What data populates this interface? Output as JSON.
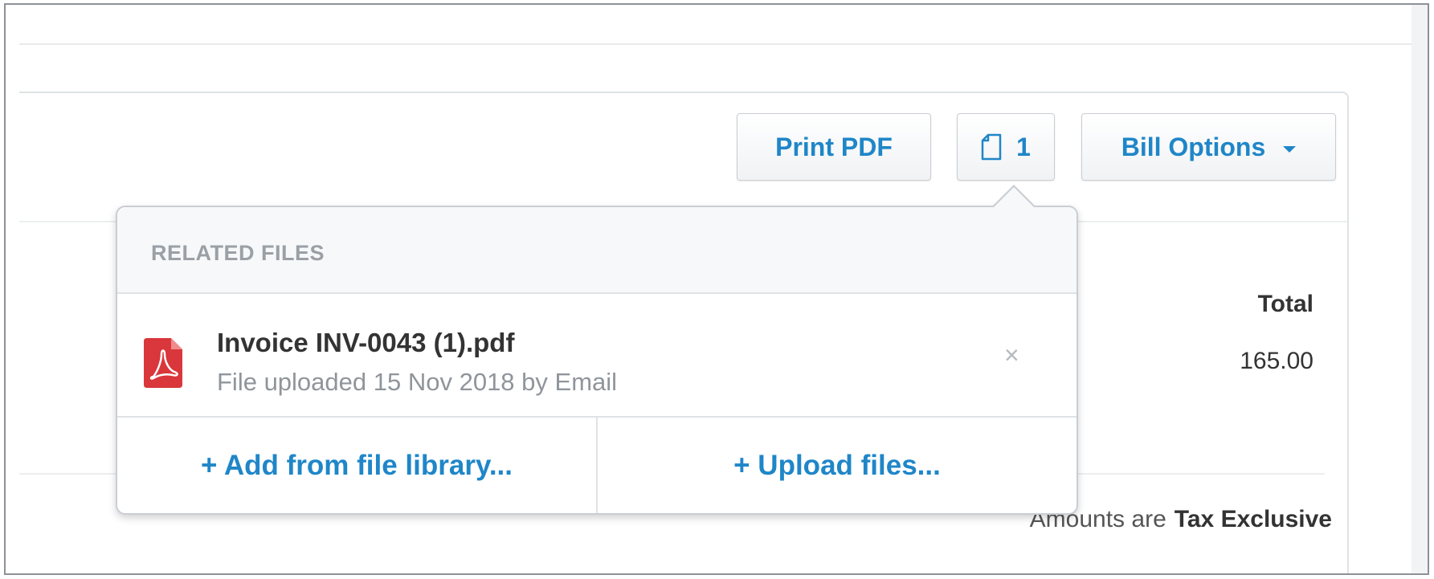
{
  "toolbar": {
    "print_pdf_label": "Print PDF",
    "files_count": "1",
    "bill_options_label": "Bill Options"
  },
  "totals": {
    "header": "Total",
    "value": "165.00"
  },
  "tax_note": {
    "prefix": "Amounts are",
    "value": "Tax Exclusive"
  },
  "related_files_popover": {
    "title": "RELATED FILES",
    "files": [
      {
        "name": "Invoice INV-0043 (1).pdf",
        "meta": "File uploaded 15 Nov 2018 by Email",
        "remove_glyph": "×"
      }
    ],
    "add_from_library_label": "+ Add from file library...",
    "upload_files_label": "+ Upload files..."
  },
  "colors": {
    "accent": "#1f86c8",
    "pdf_red": "#d9373b",
    "muted_text": "#8f959b",
    "border": "#c9ced3"
  },
  "icons": {
    "file_button_icon": "document-icon",
    "file_type_icon": "pdf-icon",
    "remove_icon": "close-icon",
    "dropdown_icon": "caret-down-icon"
  }
}
